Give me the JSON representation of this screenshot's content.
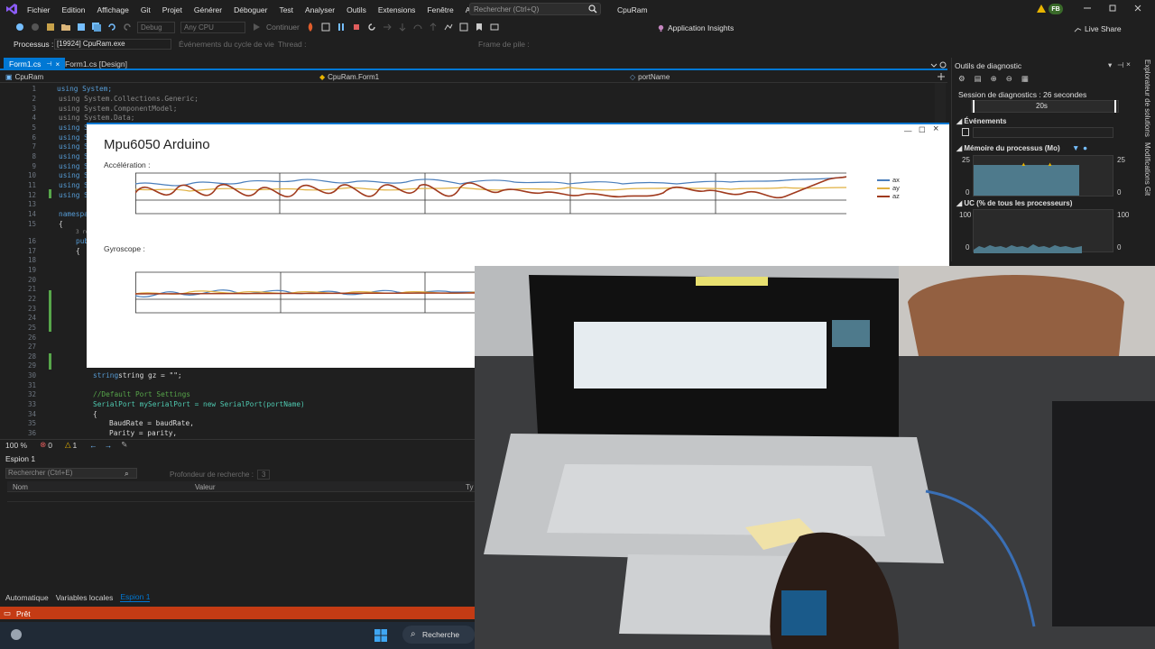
{
  "menubar": {
    "items": [
      "Fichier",
      "Edition",
      "Affichage",
      "Git",
      "Projet",
      "Générer",
      "Déboguer",
      "Test",
      "Analyser",
      "Outils",
      "Extensions",
      "Fenêtre",
      "Aide"
    ],
    "search_placeholder": "Rechercher (Ctrl+Q)",
    "project": "CpuRam",
    "avatar": "FB"
  },
  "toolbar": {
    "config": "Debug",
    "platform": "Any CPU",
    "continue": "Continuer",
    "insights": "Application Insights",
    "liveshare": "Live Share"
  },
  "procbar": {
    "process_label": "Processus :",
    "process_value": "[19924] CpuRam.exe",
    "events_label": "Événements du cycle de vie",
    "thread_label": "Thread :",
    "frame_label": "Frame de pile :"
  },
  "tabs": {
    "form1": "Form1.cs",
    "design": "Form1.cs [Design]"
  },
  "navbar": {
    "project": "CpuRam",
    "class": "CpuRam.Form1",
    "member": "portName"
  },
  "editor": {
    "lines": [
      "1",
      "2",
      "3",
      "4",
      "5",
      "6",
      "7",
      "8",
      "9",
      "10",
      "11",
      "12",
      "13",
      "14",
      "15",
      "16",
      "17",
      "18",
      "19",
      "20",
      "21",
      "22",
      "23",
      "24",
      "25",
      "26",
      "27",
      "28",
      "29",
      "30",
      "31",
      "32",
      "33",
      "34",
      "35",
      "36"
    ],
    "refs": "3 ré",
    "code": {
      "l1": "using System;",
      "l2": "using System.Collections.Generic;",
      "l3": "using System.ComponentModel;",
      "l4": "using System.Data;",
      "l5": "using S",
      "l6": "using S",
      "l7": "using S",
      "l8": "using S",
      "l9": "using S",
      "l10": "using S",
      "l11": "using S",
      "l12": "using S",
      "l14": "namespa",
      "l15": "{",
      "l16": "publ",
      "l17": "{",
      "l31": "string gz = \"\";",
      "l32": "//Default Port Settings",
      "l33": "SerialPort mySerialPort = new SerialPort(portName)",
      "l34": "{",
      "l35": "BaudRate = baudRate,",
      "l36": "Parity = parity,"
    }
  },
  "edstatus": {
    "zoom": "100 %",
    "errors": "0",
    "warnings": "1"
  },
  "watch": {
    "title": "Espion 1",
    "search_placeholder": "Rechercher (Ctrl+E)",
    "depth_label": "Profondeur de recherche :",
    "depth_value": "3",
    "col_name": "Nom",
    "col_value": "Valeur",
    "col_type": "Ty"
  },
  "bottom_tabs": [
    "Automatique",
    "Variables locales",
    "Espion 1"
  ],
  "status": {
    "text": "Prêt"
  },
  "taskbar": {
    "search": "Recherche"
  },
  "diagnostics": {
    "title": "Outils de diagnostic",
    "session": "Session de diagnostics : 26 secondes",
    "timeline_label": "20s",
    "events": "Événements",
    "memory": "Mémoire du processus (Mo)",
    "memory_max": "25",
    "memory_min": "0",
    "cpu": "UC (% de tous les processeurs)",
    "cpu_max": "100",
    "cpu_min": "0"
  },
  "vtabs": [
    "Explorateur de solutions",
    "Modifications Git"
  ],
  "app": {
    "title": "Mpu6050 Arduino",
    "accel_label": "Accélération :",
    "gyro_label": "Gyroscope :",
    "legend": [
      {
        "name": "ax",
        "color": "#4a7ebb"
      },
      {
        "name": "ay",
        "color": "#e0b040"
      },
      {
        "name": "az",
        "color": "#a03a1e"
      }
    ]
  },
  "colors": {
    "accent": "#0078d4",
    "status": "#c43b14",
    "memory_fill": "#4e7a8c"
  }
}
